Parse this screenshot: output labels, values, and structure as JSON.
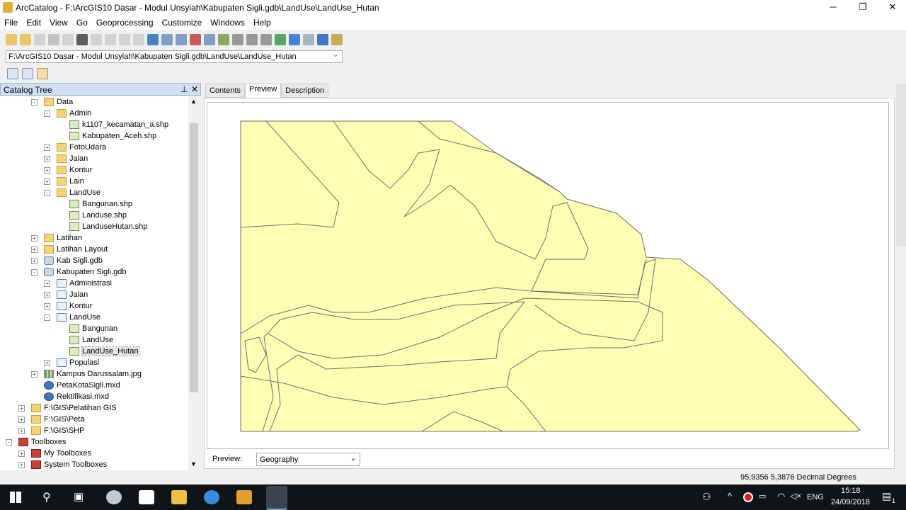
{
  "window": {
    "title": "ArcCatalog - F:\\ArcGIS10 Dasar - Modul Unsyiah\\Kabupaten Sigli.gdb\\LandUse\\LandUse_Hutan"
  },
  "menu": [
    "File",
    "Edit",
    "View",
    "Go",
    "Geoprocessing",
    "Customize",
    "Windows",
    "Help"
  ],
  "location": {
    "value": "F:\\ArcGIS10 Dasar - Modul Unsyiah\\Kabupaten Sigli.gdb\\LandUse\\LandUse_Hutan"
  },
  "catalog": {
    "title": "Catalog Tree",
    "items": [
      {
        "label": "Data",
        "type": "folder",
        "level": 2,
        "exp": "-"
      },
      {
        "label": "Admin",
        "type": "folder",
        "level": 3,
        "exp": "-"
      },
      {
        "label": "k1107_kecamatan_a.shp",
        "type": "shp",
        "level": 4,
        "exp": ""
      },
      {
        "label": "Kabupaten_Aceh.shp",
        "type": "shp",
        "level": 4,
        "exp": ""
      },
      {
        "label": "FotoUdara",
        "type": "folder",
        "level": 3,
        "exp": "+"
      },
      {
        "label": "Jalan",
        "type": "folder",
        "level": 3,
        "exp": "+"
      },
      {
        "label": "Kontur",
        "type": "folder",
        "level": 3,
        "exp": "+"
      },
      {
        "label": "Lain",
        "type": "folder",
        "level": 3,
        "exp": "+"
      },
      {
        "label": "LandUse",
        "type": "folder",
        "level": 3,
        "exp": "-"
      },
      {
        "label": "Bangunan.shp",
        "type": "shp",
        "level": 4,
        "exp": ""
      },
      {
        "label": "Landuse.shp",
        "type": "shp",
        "level": 4,
        "exp": ""
      },
      {
        "label": "LanduseHutan.shp",
        "type": "shp",
        "level": 4,
        "exp": ""
      },
      {
        "label": "Latihan",
        "type": "folder",
        "level": 2,
        "exp": "+"
      },
      {
        "label": "Latihan Layout",
        "type": "folder",
        "level": 2,
        "exp": "+"
      },
      {
        "label": "Kab Sigli.gdb",
        "type": "gdb",
        "level": 2,
        "exp": "+"
      },
      {
        "label": "Kabupaten Sigli.gdb",
        "type": "gdb",
        "level": 2,
        "exp": "-"
      },
      {
        "label": "Administrasi",
        "type": "fd",
        "level": 3,
        "exp": "+"
      },
      {
        "label": "Jalan",
        "type": "fd",
        "level": 3,
        "exp": "+"
      },
      {
        "label": "Kontur",
        "type": "fd",
        "level": 3,
        "exp": "+"
      },
      {
        "label": "LandUse",
        "type": "fd",
        "level": 3,
        "exp": "-"
      },
      {
        "label": "Bangunan",
        "type": "fc",
        "level": 4,
        "exp": ""
      },
      {
        "label": "LandUse",
        "type": "fc",
        "level": 4,
        "exp": ""
      },
      {
        "label": "LandUse_Hutan",
        "type": "fc",
        "level": 4,
        "exp": "",
        "selected": true
      },
      {
        "label": "Populasi",
        "type": "fd",
        "level": 3,
        "exp": "+"
      },
      {
        "label": "Kampus Darussalam.jpg",
        "type": "raster",
        "level": 2,
        "exp": "+"
      },
      {
        "label": "PetaKotaSigli.mxd",
        "type": "mxd",
        "level": 2,
        "exp": ""
      },
      {
        "label": "Rektifikasi.mxd",
        "type": "mxd",
        "level": 2,
        "exp": ""
      },
      {
        "label": "F:\\GIS\\Pelatihan GIS",
        "type": "folder",
        "level": 1,
        "exp": "+"
      },
      {
        "label": "F:\\GIS\\Peta",
        "type": "folder",
        "level": 1,
        "exp": "+"
      },
      {
        "label": "F:\\GIS\\SHP",
        "type": "folder",
        "level": 1,
        "exp": "+"
      },
      {
        "label": "Toolboxes",
        "type": "toolbox",
        "level": 0,
        "exp": "-"
      },
      {
        "label": "My Toolboxes",
        "type": "toolbox",
        "level": 1,
        "exp": "+"
      },
      {
        "label": "System Toolboxes",
        "type": "toolbox",
        "level": 1,
        "exp": "+"
      }
    ]
  },
  "tabs": [
    {
      "label": "Contents"
    },
    {
      "label": "Preview",
      "active": true
    },
    {
      "label": "Description"
    }
  ],
  "preview": {
    "label": "Preview:",
    "mode": "Geography",
    "fill": "#ffffb4",
    "outline": "#6e6e6e"
  },
  "status": {
    "coords": "95,9356  5,3876 Decimal Degrees"
  },
  "taskbar": {
    "lang": "ENG",
    "time": "15:18",
    "date": "24/09/2018",
    "notifications": "1"
  }
}
